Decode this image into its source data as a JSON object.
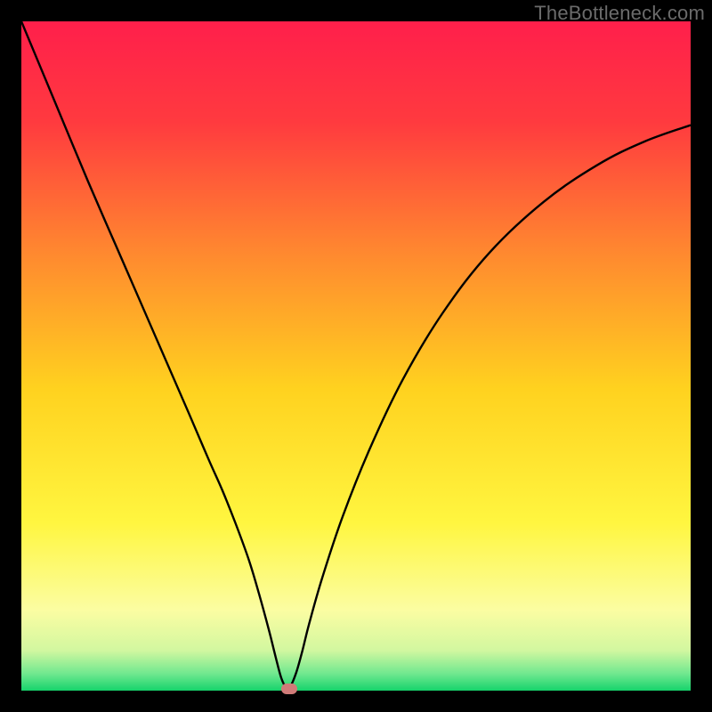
{
  "watermark": "TheBottleneck.com",
  "chart_data": {
    "type": "line",
    "title": "",
    "xlabel": "",
    "ylabel": "",
    "xlim": [
      0,
      100
    ],
    "ylim": [
      0,
      100
    ],
    "background_gradient": {
      "stops": [
        {
          "pos": 0.0,
          "color": "#ff1f4b"
        },
        {
          "pos": 0.15,
          "color": "#ff3a3f"
        },
        {
          "pos": 0.35,
          "color": "#ff8a2f"
        },
        {
          "pos": 0.55,
          "color": "#ffd21f"
        },
        {
          "pos": 0.75,
          "color": "#fff640"
        },
        {
          "pos": 0.88,
          "color": "#fbfda2"
        },
        {
          "pos": 0.94,
          "color": "#d2f7a0"
        },
        {
          "pos": 0.975,
          "color": "#6fe88f"
        },
        {
          "pos": 1.0,
          "color": "#16d36b"
        }
      ]
    },
    "series": [
      {
        "name": "bottleneck-curve",
        "color": "#000000",
        "x": [
          0,
          5,
          10,
          15,
          20,
          25,
          28,
          30,
          32,
          34,
          35.5,
          37,
          38,
          38.8,
          39.5,
          40,
          41,
          42,
          43,
          45,
          48,
          52,
          57,
          63,
          70,
          78,
          86,
          93,
          100
        ],
        "y": [
          100,
          88,
          76,
          64.5,
          53,
          41.5,
          34.5,
          30,
          25,
          19.5,
          14.5,
          9,
          5,
          2,
          0.5,
          0.3,
          2.5,
          6,
          10,
          17,
          26,
          36,
          46.5,
          56.5,
          65.5,
          73,
          78.5,
          82,
          84.5
        ]
      }
    ],
    "marker": {
      "name": "optimal-point",
      "x": 40,
      "y": 0.3,
      "color": "#cf7b78"
    }
  }
}
